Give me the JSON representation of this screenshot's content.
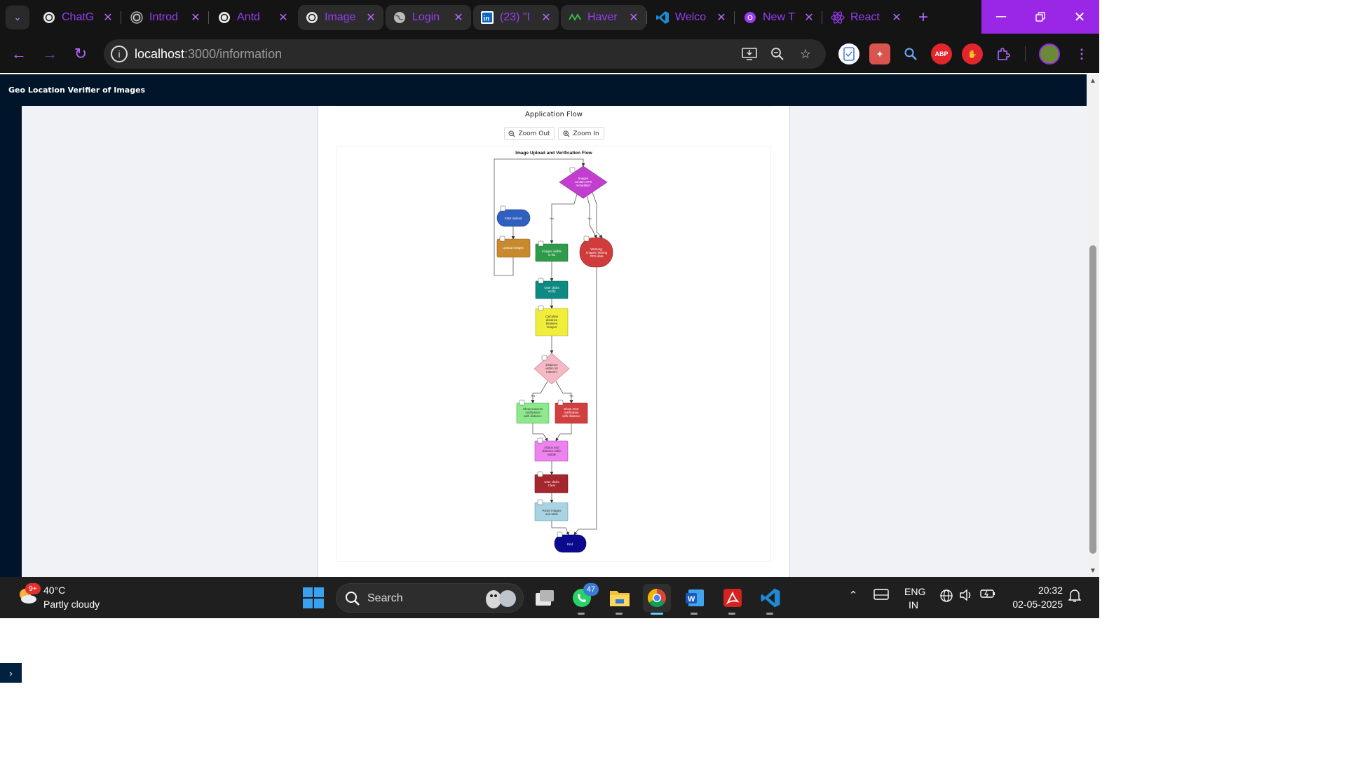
{
  "browser": {
    "tabs": [
      {
        "label": "ChatG",
        "icon": "openai-icon"
      },
      {
        "label": "Introd",
        "icon": "openai-icon"
      },
      {
        "label": "Antd",
        "icon": "openai-icon"
      },
      {
        "label": "Image",
        "icon": "openai-icon"
      },
      {
        "label": "Login",
        "icon": "globe-icon"
      },
      {
        "label": "(23) \"I",
        "icon": "linkedin-icon"
      },
      {
        "label": "Haver",
        "icon": "haver-icon"
      },
      {
        "label": "Welco",
        "icon": "vscode-icon"
      },
      {
        "label": "New T",
        "icon": "chrome-icon"
      },
      {
        "label": "React",
        "icon": "react-icon"
      }
    ],
    "url_host": "localhost",
    "url_path": ":3000/information"
  },
  "app": {
    "title": "Geo Location Verifier of Images"
  },
  "page": {
    "section_title": "Application Flow",
    "zoom_out_label": "Zoom Out",
    "zoom_in_label": "Zoom In"
  },
  "diagram": {
    "title": "Image Upload and Verification Flow",
    "nodes": {
      "start": "Start Upload",
      "upload": "Upload Images",
      "gps_q1": "Images",
      "gps_q2": "contain GPS",
      "gps_q3": "metadata?",
      "visible1": "Images visible",
      "visible2": "in list",
      "warn1": "Warning:",
      "warn2": "Images missing",
      "warn3": "GPS data",
      "verify1": "User clicks",
      "verify2": "Verify",
      "calc1": "Calculate",
      "calc2": "distance",
      "calc3": "between",
      "calc4": "images",
      "dist1": "Distance",
      "dist2": "within 18",
      "dist3": "meters?",
      "succ1": "Show success",
      "succ2": "notification",
      "succ3": "with distance",
      "err1": "Show error",
      "err2": "notification",
      "err3": "with distance",
      "status1": "Status and",
      "status2": "distance table",
      "status3": "visible",
      "clear1": "User clicks",
      "clear2": "Clear",
      "reset1": "Reset images",
      "reset2": "and table",
      "end": "End"
    },
    "edge_labels": {
      "yes1": "Yes",
      "no1": "No",
      "yes2": "Yes",
      "no2": "No"
    }
  },
  "taskbar": {
    "weather_badge": "9+",
    "temperature": "40°C",
    "condition": "Partly cloudy",
    "search_label": "Search",
    "whatsapp_badge": "47",
    "lang_line1": "ENG",
    "lang_line2": "IN",
    "time": "20:32",
    "date": "02-05-2025"
  },
  "colors": {
    "accent": "#9a27e6",
    "app_header": "#001529"
  }
}
